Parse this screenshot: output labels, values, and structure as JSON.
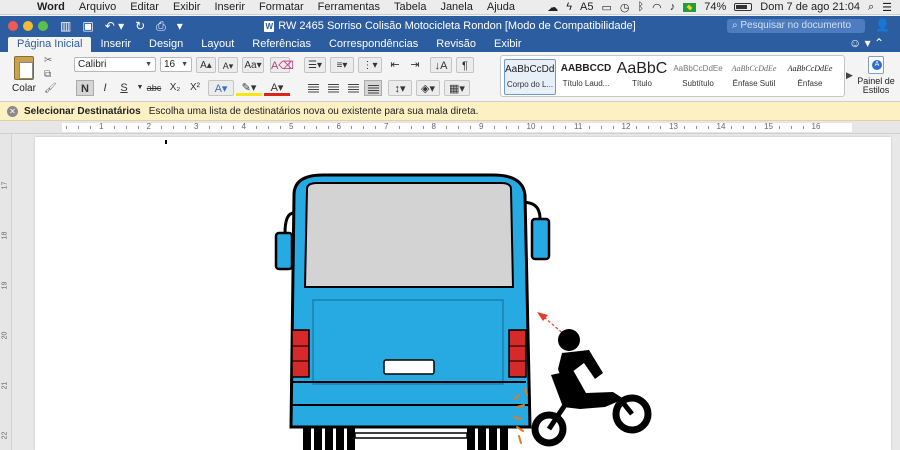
{
  "menubar": {
    "app": "Word",
    "items": [
      "Arquivo",
      "Editar",
      "Exibir",
      "Inserir",
      "Formatar",
      "Ferramentas",
      "Tabela",
      "Janela",
      "Ajuda"
    ],
    "status": {
      "adobe_count": "5",
      "battery": "74%",
      "datetime": "Dom 7 de ago  21:04"
    }
  },
  "titlebar": {
    "document_title": "RW 2465 Sorriso Colisão Motocicleta Rondon [Modo de Compatibilidade]",
    "search_placeholder": "Pesquisar no documento"
  },
  "tabs": [
    "Página Inicial",
    "Inserir",
    "Design",
    "Layout",
    "Referências",
    "Correspondências",
    "Revisão",
    "Exibir"
  ],
  "active_tab": "Página Inicial",
  "ribbon": {
    "paste_label": "Colar",
    "font_name": "Calibri",
    "font_size": "16",
    "bold": "N",
    "italic": "I",
    "underline": "S",
    "strike": "abc",
    "subscript": "X₂",
    "superscript": "X²",
    "styles": [
      {
        "preview": "AaBbCcDdE",
        "name": "Corpo do L..."
      },
      {
        "preview": "AABBCCD",
        "name": "Título Laud..."
      },
      {
        "preview": "AaBbC",
        "name": "Título"
      },
      {
        "preview": "AaBbCcDdEe",
        "name": "Subtítulo"
      },
      {
        "preview": "AaBbCcDdEe",
        "name": "Ênfase Sutil"
      },
      {
        "preview": "AaBbCcDdEe",
        "name": "Ênfase"
      }
    ],
    "styles_pane_label": "Painel de Estilos"
  },
  "message_bar": {
    "title": "Selecionar Destinatários",
    "text": "Escolha uma lista de destinatários nova ou existente para sua mala direta."
  },
  "ruler_h": [
    "1",
    "2",
    "3",
    "4",
    "5",
    "6",
    "7",
    "8",
    "9",
    "10",
    "11",
    "12",
    "13",
    "14",
    "15",
    "16"
  ],
  "ruler_v": [
    "17",
    "18",
    "19",
    "20",
    "21",
    "22"
  ],
  "colors": {
    "ribbon_blue": "#2c5da0",
    "bus_blue": "#27aae1",
    "tail_light": "#d62a2a",
    "impact_orange": "#e07b1e",
    "arrow_red": "#e53b2b"
  }
}
